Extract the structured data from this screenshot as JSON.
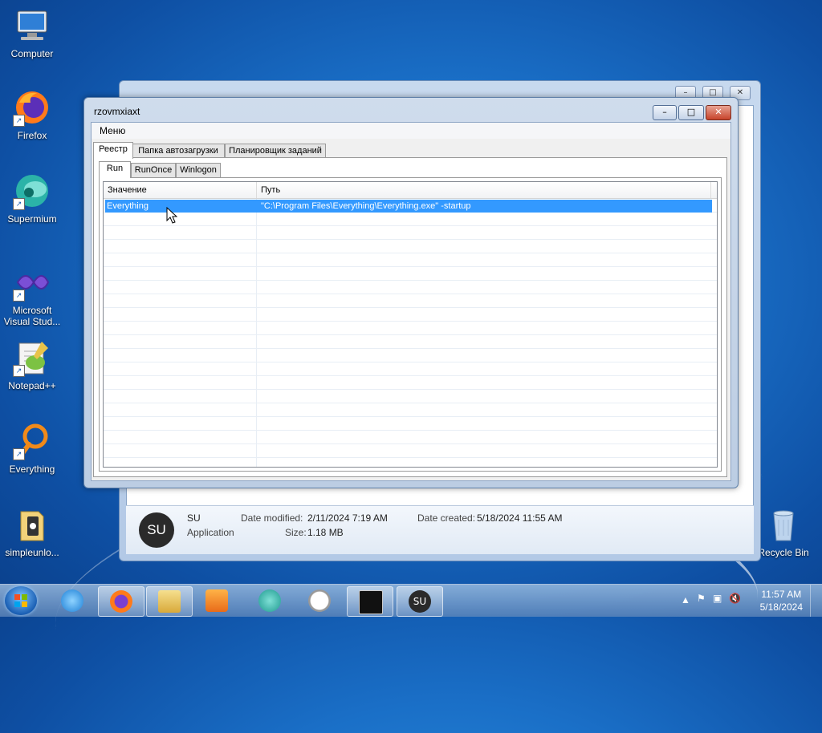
{
  "desktop": {
    "icons": [
      {
        "label": "Computer"
      },
      {
        "label": "Firefox"
      },
      {
        "label": "Supermium"
      },
      {
        "label": "Microsoft Visual Stud..."
      },
      {
        "label": "Notepad++"
      },
      {
        "label": "Everything"
      },
      {
        "label": "simpleunlo..."
      },
      {
        "label": "Recycle Bin"
      }
    ]
  },
  "background_window": {
    "details": {
      "name": "SU",
      "type": "Application",
      "date_modified_label": "Date modified:",
      "date_modified": "2/11/2024 7:19 AM",
      "size_label": "Size:",
      "size": "1.18 MB",
      "date_created_label": "Date created:",
      "date_created": "5/18/2024 11:55 AM"
    }
  },
  "window": {
    "title": "rzovmxiaxt",
    "menu": "Меню",
    "tabs": [
      "Реестр",
      "Папка автозагрузки",
      "Планировщик заданий"
    ],
    "subtabs": [
      "Run",
      "RunOnce",
      "Winlogon"
    ],
    "columns": [
      "Значение",
      "Путь"
    ],
    "rows": [
      {
        "value": "Everything",
        "path": "\"C:\\Program Files\\Everything\\Everything.exe\" -startup",
        "selected": true
      }
    ]
  },
  "taskbar": {
    "clock_time": "11:57 AM",
    "clock_date": "5/18/2024"
  },
  "colors": {
    "selection": "#3399ff",
    "desktop": "#1a6fc7"
  }
}
